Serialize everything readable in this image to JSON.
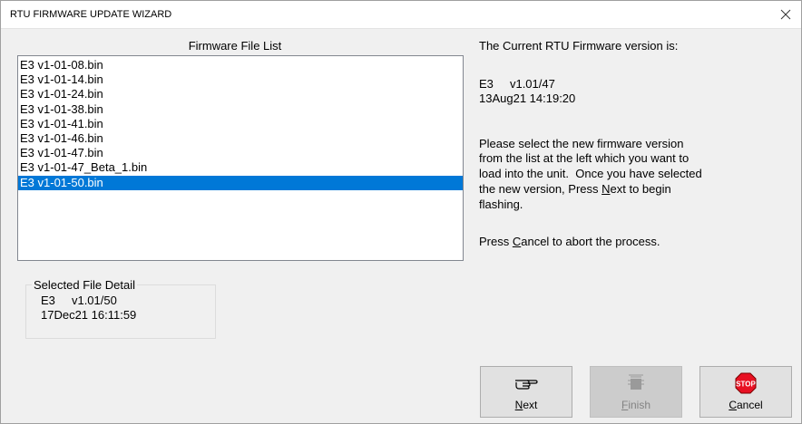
{
  "window": {
    "title": "RTU FIRMWARE UPDATE WIZARD",
    "close_glyph": "✕"
  },
  "file_list": {
    "caption": "Firmware File List",
    "items": [
      {
        "label": "E3 v1-01-08.bin",
        "selected": false
      },
      {
        "label": "E3 v1-01-14.bin",
        "selected": false
      },
      {
        "label": "E3 v1-01-24.bin",
        "selected": false
      },
      {
        "label": "E3 v1-01-38.bin",
        "selected": false
      },
      {
        "label": "E3 v1-01-41.bin",
        "selected": false
      },
      {
        "label": "E3 v1-01-46.bin",
        "selected": false
      },
      {
        "label": "E3 v1-01-47.bin",
        "selected": false
      },
      {
        "label": "E3 v1-01-47_Beta_1.bin",
        "selected": false
      },
      {
        "label": "E3 v1-01-50.bin",
        "selected": true
      }
    ]
  },
  "selected_detail": {
    "legend": "Selected File Detail",
    "line1": "E3     v1.01/50",
    "line2": "17Dec21 16:11:59"
  },
  "current": {
    "heading": "The Current RTU Firmware version is:",
    "version_line": "E3     v1.01/47",
    "date_line": "13Aug21 14:19:20"
  },
  "instructions": {
    "line1": "Please select the new firmware version",
    "line2": "from the list at the left which you want to",
    "line3": "load into the unit.  Once you have selected",
    "line4_pre": "the new version, Press ",
    "line4_key": "N",
    "line4_post": "ext to begin",
    "line5": "flashing.",
    "cancel_pre": "Press ",
    "cancel_key": "C",
    "cancel_post": "ancel to abort the process."
  },
  "buttons": {
    "next": {
      "key": "N",
      "rest": "ext",
      "icon": "pointing-hand-icon",
      "enabled": true
    },
    "finish": {
      "key": "F",
      "rest": "inish",
      "icon": "flash-chip-icon",
      "enabled": false
    },
    "cancel": {
      "key": "C",
      "rest": "ancel",
      "icon": "stop-sign-icon",
      "icon_text": "STOP",
      "enabled": true
    }
  },
  "colors": {
    "selection": "#0078d7",
    "stop_red": "#e81123"
  }
}
